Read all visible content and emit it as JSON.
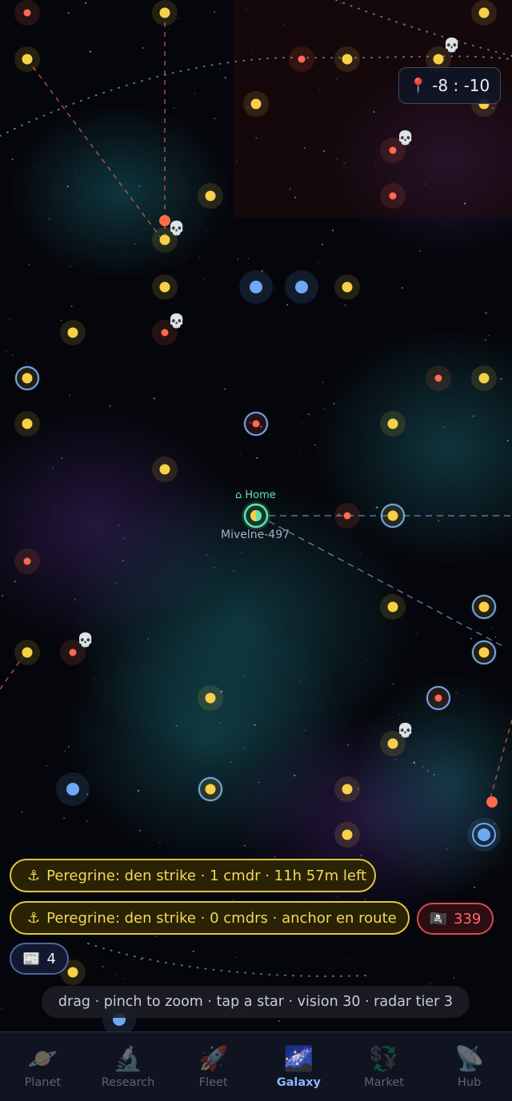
{
  "map": {
    "coordinates": "-8 : -10",
    "home_label": "⌂ Home",
    "home_system_name": "Mivelne-497"
  },
  "operations": [
    {
      "text": "Peregrine: den strike · 1 cmdr · 11h 57m left"
    },
    {
      "text": "Peregrine: den strike · 0 cmdrs · anchor en route"
    }
  ],
  "pirate_count": "339",
  "news_count": "4",
  "hint": "drag · pinch to zoom · tap a star · vision 30 · radar tier 3",
  "nav": {
    "items": [
      {
        "label": "Planet",
        "icon": "🪐"
      },
      {
        "label": "Research",
        "icon": "🔬"
      },
      {
        "label": "Fleet",
        "icon": "🚀"
      },
      {
        "label": "Galaxy",
        "icon": "🌌"
      },
      {
        "label": "Market",
        "icon": "💱"
      },
      {
        "label": "Hub",
        "icon": "📡"
      }
    ],
    "active": "Galaxy"
  },
  "colors": {
    "star_yellow": "#f6d048",
    "star_red": "#ff6a4d",
    "star_blue": "#6fa8f5",
    "home_green": "#5fe6a8",
    "op_gold": "#e0c542",
    "pirate_red": "#d84b52",
    "nav_active": "#8fb4ff"
  }
}
